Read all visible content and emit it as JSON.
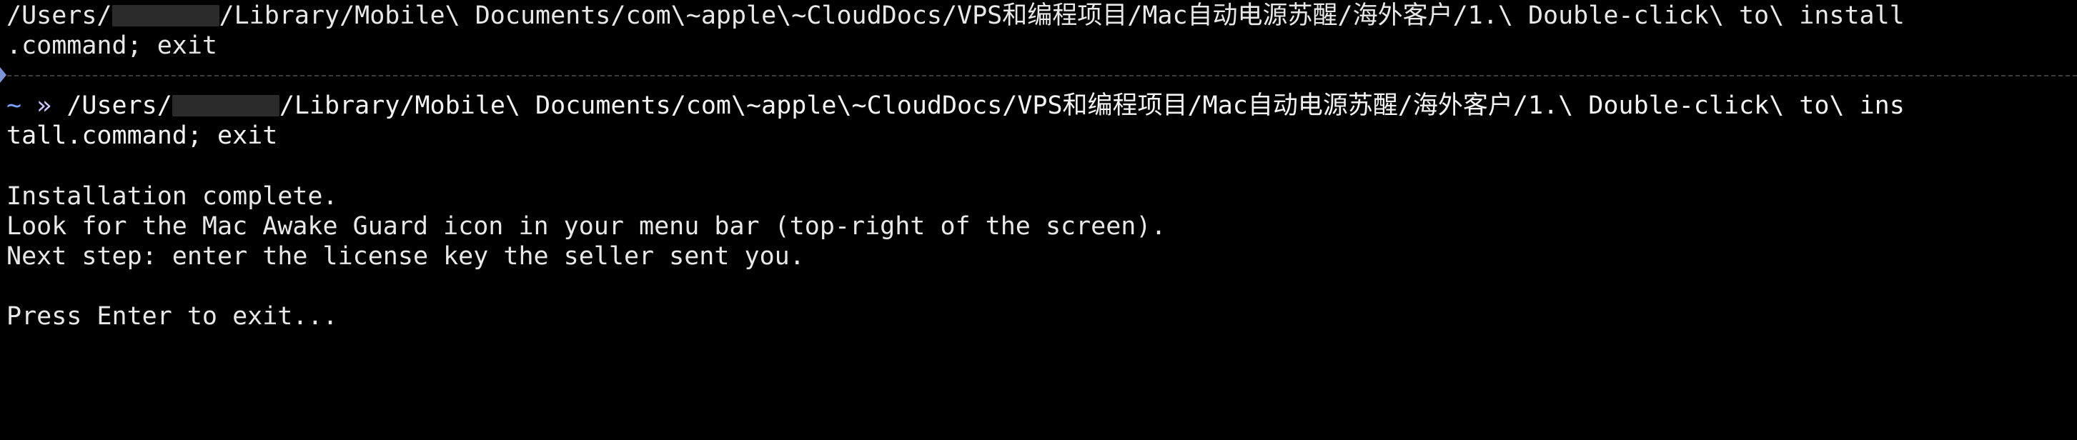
{
  "terminal": {
    "prev_command": {
      "part1": "/Users/",
      "part2": "/Library/Mobile\\ Documents/com\\~apple\\~CloudDocs/VPS和编程项目/Mac自动电源苏醒/海外客户/1.\\ Double-click\\ to\\ install",
      "part3": ".command; exit"
    },
    "prompt": {
      "tilde": "~",
      "arrow": "»"
    },
    "command": {
      "part1": "/Users/",
      "part2": "/Library/Mobile\\ Documents/com\\~apple\\~CloudDocs/VPS和编程项目/Mac自动电源苏醒/海外客户/1.\\ Double-click\\ to\\ ins",
      "part3": "tall.command; exit"
    },
    "output": [
      "Installation complete.",
      "Look for the Mac Awake Guard icon in your menu bar (top-right of the screen).",
      "Next step: enter the license key the seller sent you.",
      "Press Enter to exit..."
    ],
    "colors": {
      "background": "#000000",
      "text": "#e8e8e8",
      "prompt_tilde": "#7ea0ff",
      "separator": "#3b3b3b"
    }
  }
}
